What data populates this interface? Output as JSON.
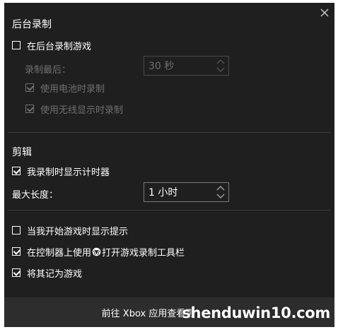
{
  "background_recording": {
    "title": "后台录制",
    "record_in_background": {
      "label": "在后台录制游戏",
      "checked": false
    },
    "record_last_label": "录制最后：",
    "record_last_value": "30 秒",
    "record_on_battery": {
      "label": "使用电池时录制",
      "checked": true
    },
    "record_wireless_display": {
      "label": "使用无线显示时录制",
      "checked": true
    }
  },
  "clips": {
    "title": "剪辑",
    "show_timer": {
      "label": "我录制时显示计时器",
      "checked": true
    },
    "max_length_label": "最大长度：",
    "max_length_value": "1 小时"
  },
  "misc": {
    "show_tips": {
      "label": "当我开始游戏时显示提示",
      "checked": false
    },
    "controller_open_prefix": "在控制器上使用",
    "controller_open_suffix": "打开游戏录制工具栏",
    "controller_open_checked": true,
    "remember_as_game": {
      "label": "将其记为游戏",
      "checked": true
    }
  },
  "footer": {
    "link": "前往 Xbox 应用查看更"
  },
  "watermark": "shenduwin10.com",
  "colors": {
    "panel_bg": "#1f1f1f",
    "footer_bg": "#2d2d2d",
    "disabled_text": "#6f6f6f",
    "divider": "#3f3f3f"
  }
}
